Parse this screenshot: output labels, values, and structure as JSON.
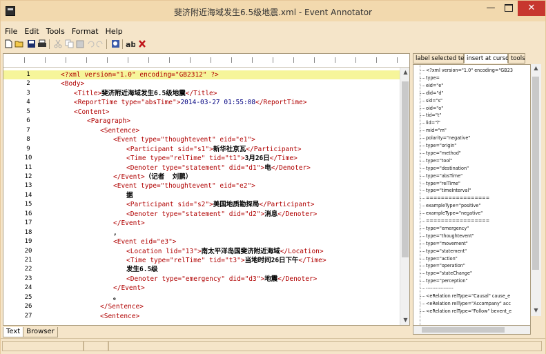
{
  "window": {
    "title": "斐济附近海域发生6.5级地震.xml - Event Annotator",
    "minimize": "—",
    "close": "✕"
  },
  "menu": [
    "File",
    "Edit",
    "Tools",
    "Format",
    "Help"
  ],
  "toolbar_icons": [
    "new-file-icon",
    "open-folder-icon",
    "save-icon",
    "print-icon",
    "cut-icon",
    "copy-icon",
    "paste-icon",
    "undo-icon",
    "redo-icon",
    "find-icon",
    "replace-icon",
    "delete-icon"
  ],
  "editor": {
    "lines": [
      {
        "n": "1",
        "indent": 0,
        "parts": [
          [
            "tag",
            "<?xml version=\"1.0\" encoding=\"GB2312\" ?>"
          ]
        ]
      },
      {
        "n": "2",
        "indent": 0,
        "parts": [
          [
            "tag",
            "<Body>"
          ]
        ]
      },
      {
        "n": "3",
        "indent": 1,
        "parts": [
          [
            "tag",
            "<Title>"
          ],
          [
            "cn",
            "斐济附近海域发生6.5级地震"
          ],
          [
            "tag",
            "</Title>"
          ]
        ]
      },
      {
        "n": "4",
        "indent": 1,
        "parts": [
          [
            "tag",
            "<ReportTime type=\"absTime\">"
          ],
          [
            "val",
            "2014-03-27 01:55:08"
          ],
          [
            "tag",
            "</ReportTime>"
          ]
        ]
      },
      {
        "n": "5",
        "indent": 1,
        "parts": [
          [
            "tag",
            "<Content>"
          ]
        ]
      },
      {
        "n": "6",
        "indent": 2,
        "parts": [
          [
            "tag",
            "<Paragraph>"
          ]
        ]
      },
      {
        "n": "7",
        "indent": 3,
        "parts": [
          [
            "tag",
            "<Sentence>"
          ]
        ]
      },
      {
        "n": "8",
        "indent": 4,
        "parts": [
          [
            "tag",
            "<Event type=\"thoughtevent\" eid=\"e1\">"
          ]
        ]
      },
      {
        "n": "9",
        "indent": 5,
        "parts": [
          [
            "tag",
            "<Participant sid=\"s1\">"
          ],
          [
            "cn",
            "新华社京瓦"
          ],
          [
            "tag",
            "</Participant>"
          ]
        ]
      },
      {
        "n": "10",
        "indent": 5,
        "parts": [
          [
            "tag",
            "<Time type=\"relTime\" tid=\"t1\">"
          ],
          [
            "cn",
            "3月26日"
          ],
          [
            "tag",
            "</Time>"
          ]
        ]
      },
      {
        "n": "11",
        "indent": 5,
        "parts": [
          [
            "tag",
            "<Denoter type=\"statement\" did=\"d1\">"
          ],
          [
            "cn",
            "电"
          ],
          [
            "tag",
            "</Denoter>"
          ]
        ]
      },
      {
        "n": "12",
        "indent": 4,
        "parts": [
          [
            "tag",
            "</Event>"
          ],
          [
            "cn",
            "（记者  刘鹏）"
          ]
        ]
      },
      {
        "n": "13",
        "indent": 4,
        "parts": [
          [
            "tag",
            "<Event type=\"thoughtevent\" eid=\"e2\">"
          ]
        ]
      },
      {
        "n": "14",
        "indent": 5,
        "parts": [
          [
            "cn",
            "据"
          ]
        ]
      },
      {
        "n": "15",
        "indent": 5,
        "parts": [
          [
            "tag",
            "<Participant sid=\"s2\">"
          ],
          [
            "cn",
            "美国地质勘探局"
          ],
          [
            "tag",
            "</Participant>"
          ]
        ]
      },
      {
        "n": "16",
        "indent": 5,
        "parts": [
          [
            "tag",
            "<Denoter type=\"statement\" did=\"d2\">"
          ],
          [
            "cn",
            "消息"
          ],
          [
            "tag",
            "</Denoter>"
          ]
        ]
      },
      {
        "n": "17",
        "indent": 4,
        "parts": [
          [
            "tag",
            "</Event>"
          ]
        ]
      },
      {
        "n": "18",
        "indent": 4,
        "parts": [
          [
            "cn",
            ","
          ]
        ]
      },
      {
        "n": "19",
        "indent": 4,
        "parts": [
          [
            "tag",
            "<Event eid=\"e3\">"
          ]
        ]
      },
      {
        "n": "20",
        "indent": 5,
        "parts": [
          [
            "tag",
            "<Location lid=\"13\">"
          ],
          [
            "cn",
            "南太平洋岛国斐济附近海域"
          ],
          [
            "tag",
            "</Location>"
          ]
        ]
      },
      {
        "n": "21",
        "indent": 5,
        "parts": [
          [
            "tag",
            "<Time type=\"relTime\" tid=\"t3\">"
          ],
          [
            "cn",
            "当地时间26日下午"
          ],
          [
            "tag",
            "</Time>"
          ]
        ]
      },
      {
        "n": "22",
        "indent": 5,
        "parts": [
          [
            "cn",
            "发生6.5级"
          ]
        ]
      },
      {
        "n": "23",
        "indent": 5,
        "parts": [
          [
            "tag",
            "<Denoter type=\"emergency\" did=\"d3\">"
          ],
          [
            "cn",
            "地震"
          ],
          [
            "tag",
            "</Denoter>"
          ]
        ]
      },
      {
        "n": "24",
        "indent": 4,
        "parts": [
          [
            "tag",
            "</Event>"
          ]
        ]
      },
      {
        "n": "25",
        "indent": 4,
        "parts": [
          [
            "cn",
            "。"
          ]
        ]
      },
      {
        "n": "26",
        "indent": 3,
        "parts": [
          [
            "tag",
            "</Sentence>"
          ]
        ]
      },
      {
        "n": "27",
        "indent": 3,
        "parts": [
          [
            "tag",
            "<Sentence>"
          ]
        ]
      }
    ]
  },
  "bottom_tabs": [
    "Text",
    "Browser"
  ],
  "right_panel": {
    "tabs": [
      "label selected text",
      "insert at cursor",
      "tools"
    ],
    "items": [
      "<?xml version=\"1.0\" encoding=\"GB23",
      "type=",
      "eid=\"e\"",
      "did=\"d\"",
      "sid=\"s\"",
      "oid=\"o\"",
      "tid=\"t\"",
      "lid=\"l\"",
      "mid=\"m\"",
      "polarity=\"negative\"",
      "type=\"origin\"",
      "type=\"method\"",
      "type=\"tool\"",
      "type=\"destination\"",
      "type=\"absTime\"",
      "type=\"relTime\"",
      "type=\"timeInterval\"",
      "=================",
      "exampleType=\"positive\"",
      "exampleType=\"negative\"",
      "=================",
      "type=\"emergency\"",
      "type=\"thoughtevent\"",
      "type=\"movement\"",
      "type=\"statement\"",
      "type=\"action\"",
      "type=\"operation\"",
      "type=\"stateChange\"",
      "type=\"perception\"",
      "-----------------",
      "<eRelation relType=\"Causal\" cause_e",
      "<eRelation relType=\"Accompany\" acc",
      "<eRelation relType=\"Follow\" bevent_e"
    ]
  }
}
